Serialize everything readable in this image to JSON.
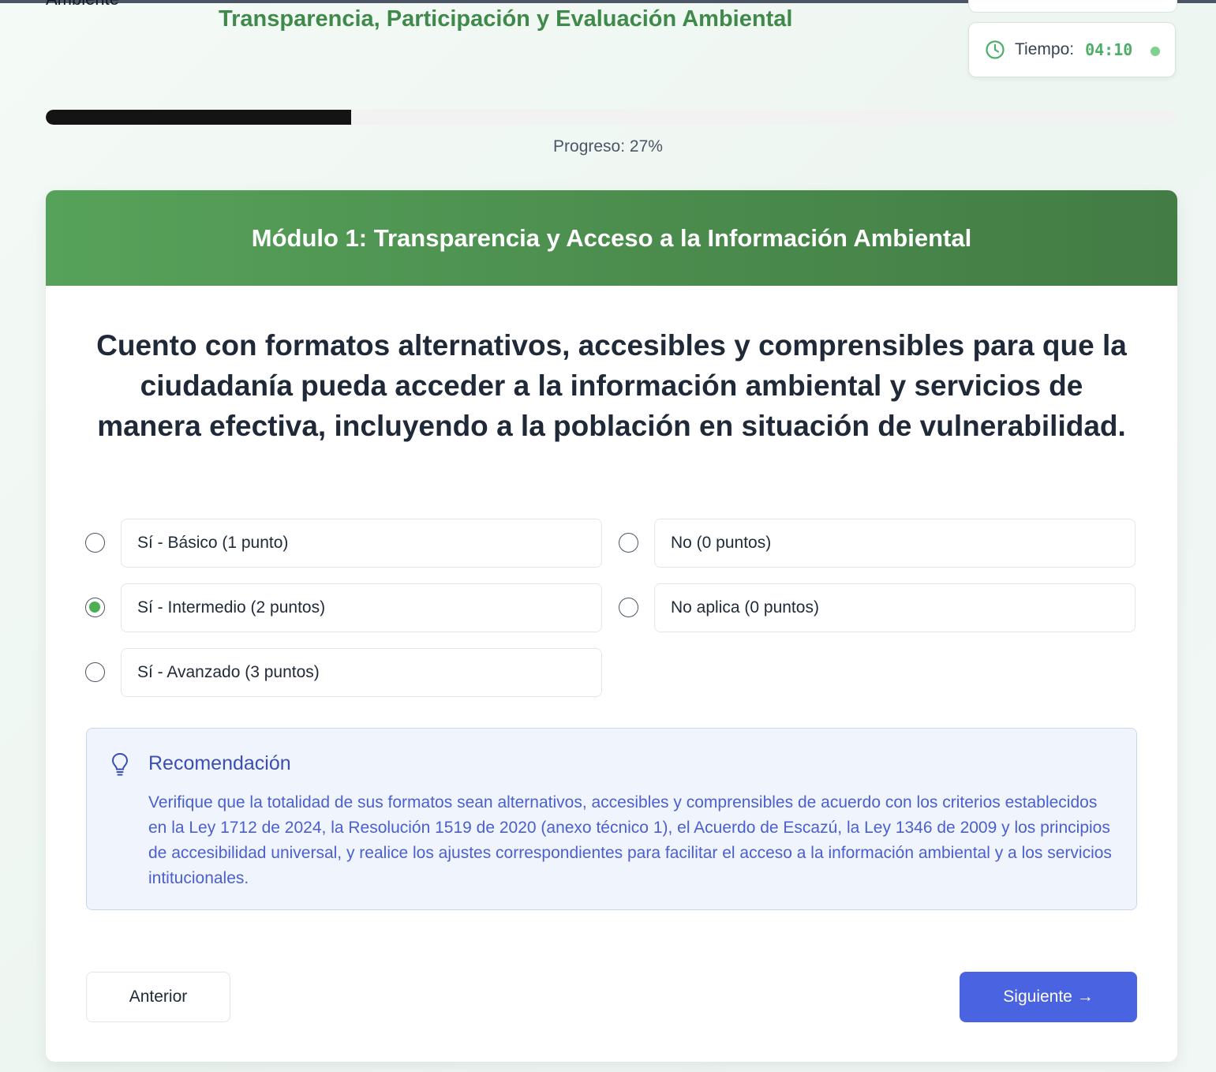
{
  "header": {
    "cut_label": "Ambiente",
    "title": "Transparencia, Participación y Evaluación Ambiental"
  },
  "timer": {
    "label": "Tiempo:",
    "value": "04:10",
    "icon": "clock-icon",
    "status_color": "#7fcf8e"
  },
  "progress": {
    "percent": 27,
    "label": "Progreso: 27%"
  },
  "module": {
    "title": "Módulo 1: Transparencia y Acceso a la Información Ambiental"
  },
  "question": {
    "text": "Cuento con formatos alternativos, accesibles y comprensibles para que la ciudadanía pueda acceder a la información ambiental y servicios de manera efectiva, incluyendo a la población en situación de vulnerabilidad."
  },
  "options": [
    {
      "label": "Sí - Básico (1 punto)",
      "selected": false
    },
    {
      "label": "No (0 puntos)",
      "selected": false
    },
    {
      "label": "Sí - Intermedio (2 puntos)",
      "selected": true
    },
    {
      "label": "No aplica (0 puntos)",
      "selected": false
    },
    {
      "label": "Sí - Avanzado (3 puntos)",
      "selected": false
    }
  ],
  "recommendation": {
    "title": "Recomendación",
    "text": "Verifique que la totalidad de sus formatos sean alternativos, accesibles y comprensibles de acuerdo con los criterios establecidos en la Ley 1712 de 2024, la Resolución 1519 de 2020 (anexo técnico 1), el Acuerdo de Escazú, la Ley 1346 de 2009 y los principios de accesibilidad universal, y realice los ajustes correspondientes para facilitar el acceso a la información ambiental y a los servicios intitucionales.",
    "icon": "lightbulb-icon"
  },
  "nav": {
    "prev_label": "Anterior",
    "next_label": "Siguiente →"
  },
  "colors": {
    "brand_green": "#3f8a4a",
    "header_green": "#4a8a4c",
    "accent_blue": "#4a63e0",
    "selected_radio": "#4caf50"
  }
}
